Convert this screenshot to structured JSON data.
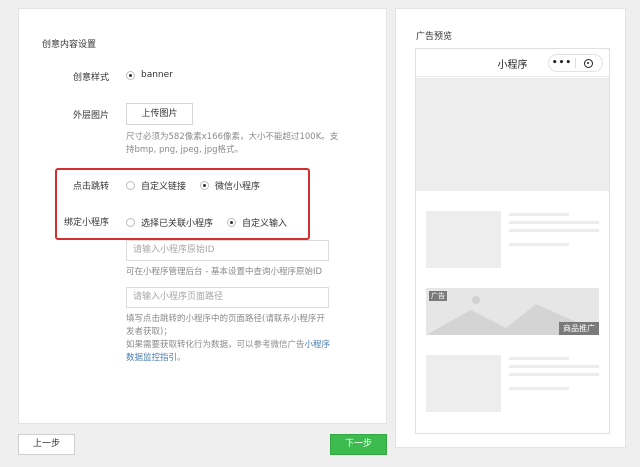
{
  "settings": {
    "title": "创意内容设置",
    "style_label": "创意样式",
    "style_option": "banner",
    "image_label": "外层图片",
    "upload_button": "上传图片",
    "image_hint_1": "尺寸必须为582像素x166像素，大小不能超过100K。支",
    "image_hint_2": "持bmp, png, jpeg, jpg格式。",
    "jump_label": "点击跳转",
    "jump_options": [
      "自定义链接",
      "微信小程序"
    ],
    "jump_selected": "微信小程序",
    "bind_label": "绑定小程序",
    "bind_options": [
      "选择已关联小程序",
      "自定义输入"
    ],
    "bind_selected": "自定义输入",
    "appid_placeholder": "请输入小程序原始ID",
    "appid_hint": "可在小程序管理后台 - 基本设置中查询小程序原始ID",
    "path_placeholder": "请输入小程序页面路径",
    "path_hint_1": "填写点击跳转的小程序中的页面路径(请联系小程序开",
    "path_hint_2": "发者获取)；",
    "path_hint_3": "如果需要获取转化行为数据，可以参考微信广告",
    "path_hint_link_1": "小程序",
    "path_hint_link_2": "数据监控指引",
    "path_hint_end": "。"
  },
  "footer": {
    "prev_button": "上一步",
    "next_button": "下一步"
  },
  "preview": {
    "title": "广告预览",
    "phone_title": "小程序",
    "capsule_more": "•••",
    "ad_tag": "广告",
    "ad_promo": "商品推广"
  },
  "colors": {
    "highlight_border": "#d23030",
    "primary_button": "#3dbb4e",
    "link": "#4a7cb0"
  }
}
